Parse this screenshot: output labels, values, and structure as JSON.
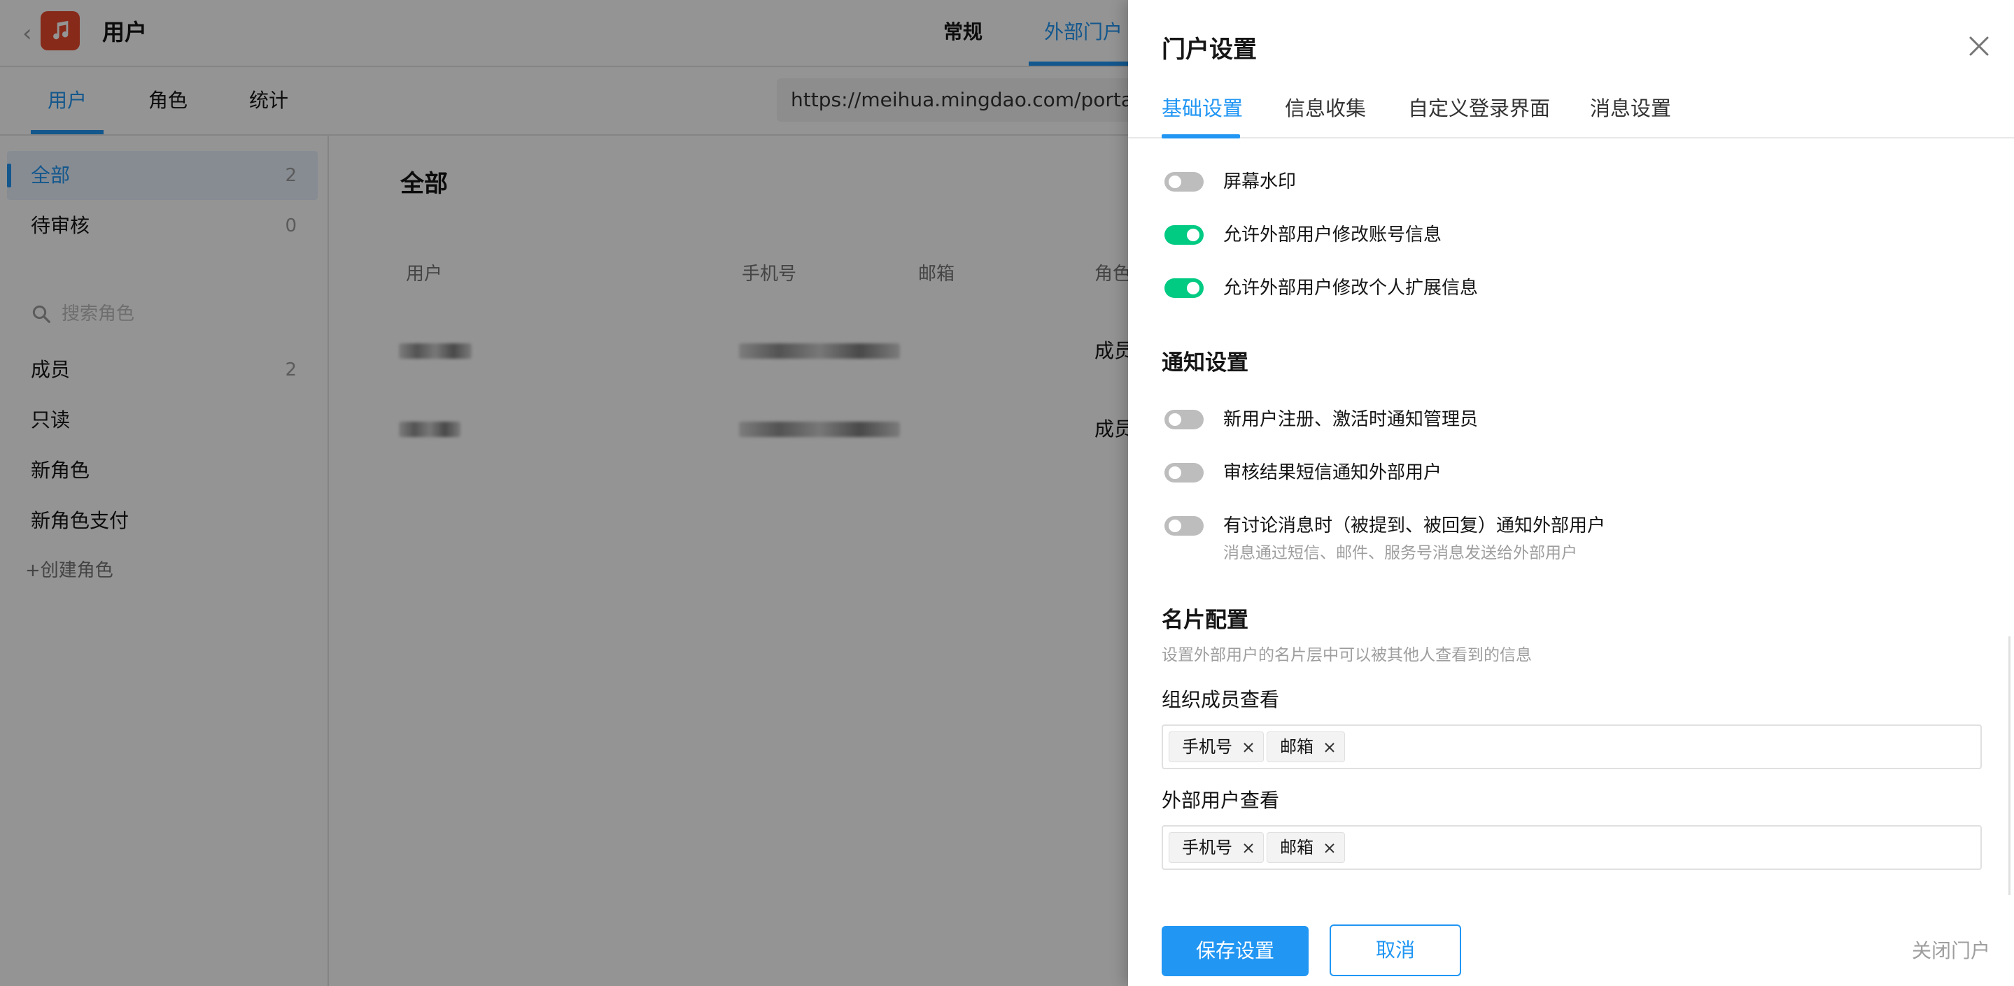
{
  "app": {
    "title": "用户",
    "top_tabs": [
      "常规",
      "外部门户"
    ],
    "sub_tabs": [
      "用户",
      "角色",
      "统计"
    ],
    "portal_url": "https://meihua.mingdao.com/portal/ap",
    "sidebar": {
      "groups": [
        {
          "label": "全部",
          "count": "2"
        },
        {
          "label": "待审核",
          "count": "0"
        }
      ],
      "search_placeholder": "搜索角色",
      "roles": [
        {
          "label": "成员",
          "count": "2"
        },
        {
          "label": "只读",
          "count": ""
        },
        {
          "label": "新角色",
          "count": ""
        },
        {
          "label": "新角色支付",
          "count": ""
        }
      ],
      "create_role": "+创建角色"
    },
    "main": {
      "title": "全部",
      "columns": [
        "用户",
        "手机号",
        "邮箱",
        "角色"
      ],
      "rows": [
        {
          "role": "成员"
        },
        {
          "role": "成员"
        }
      ]
    }
  },
  "drawer": {
    "title": "门户设置",
    "tabs": [
      "基础设置",
      "信息收集",
      "自定义登录界面",
      "消息设置"
    ],
    "basic_options": [
      {
        "label": "屏幕水印",
        "on": false
      },
      {
        "label": "允许外部用户修改账号信息",
        "on": true
      },
      {
        "label": "允许外部用户修改个人扩展信息",
        "on": true
      }
    ],
    "notify": {
      "title": "通知设置",
      "options": [
        {
          "label": "新用户注册、激活时通知管理员",
          "on": false
        },
        {
          "label": "审核结果短信通知外部用户",
          "on": false
        },
        {
          "label": "有讨论消息时（被提到、被回复）通知外部用户",
          "on": false,
          "desc": "消息通过短信、邮件、服务号消息发送给外部用户"
        }
      ]
    },
    "card": {
      "title": "名片配置",
      "desc": "设置外部用户的名片层中可以被其他人查看到的信息",
      "org_label": "组织成员查看",
      "org_tags": [
        "手机号",
        "邮箱"
      ],
      "ext_label": "外部用户查看",
      "ext_tags": [
        "手机号",
        "邮箱"
      ]
    },
    "buttons": {
      "save": "保存设置",
      "cancel": "取消",
      "close_portal": "关闭门户"
    }
  },
  "colors": {
    "accent": "#2196f3",
    "switch_on": "#01ca83",
    "switch_off": "#bdbdbd",
    "app_icon": "#e8492d"
  }
}
